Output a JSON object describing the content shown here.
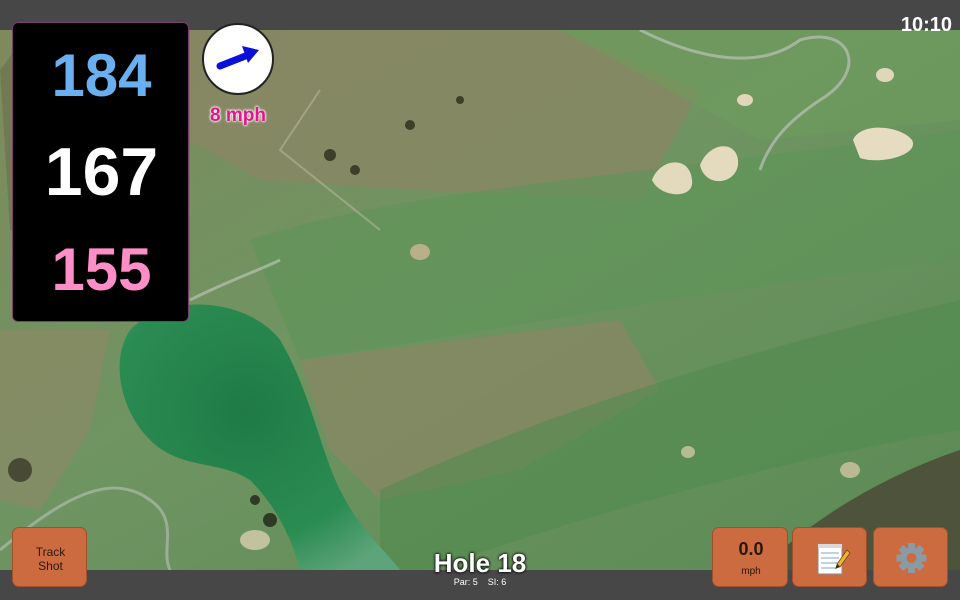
{
  "status": {
    "time": "10:10"
  },
  "distances": {
    "back": "184",
    "center": "167",
    "front": "155"
  },
  "wind": {
    "speed_label": "8 mph",
    "direction_icon": "arrow-icon"
  },
  "hole": {
    "title": "Hole 18",
    "par": "Par: 5",
    "si": "SI: 6"
  },
  "buttons": {
    "track_shot_line1": "Track",
    "track_shot_line2": "Shot",
    "wind_value": "0.0",
    "wind_unit": "mph",
    "notes_icon": "notepad-icon",
    "settings_icon": "gear-icon"
  },
  "colors": {
    "back_distance": "#6ab0f0",
    "center_distance": "#ffffff",
    "front_distance": "#ff8dc8",
    "wind_label": "#e6138a",
    "button": "#cd6b40"
  }
}
